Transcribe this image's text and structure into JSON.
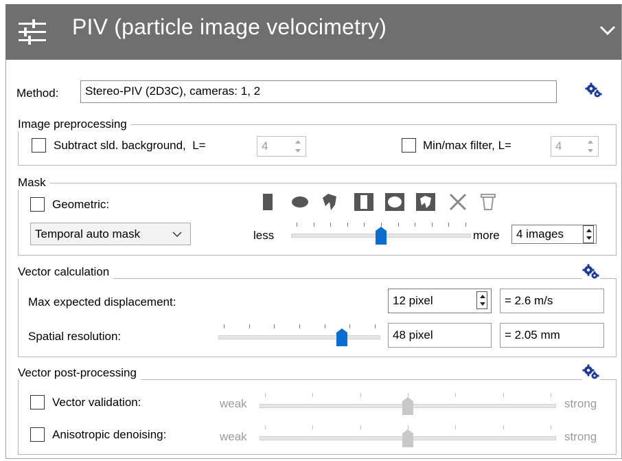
{
  "header": {
    "title": "PIV (particle image velocimetry)",
    "icons": [
      "sliders-icon",
      "chevron-down-icon"
    ]
  },
  "method": {
    "label": "Method:",
    "value": "Stereo-PIV (2D3C), cameras: 1, 2",
    "settings_icon": "gears-icon"
  },
  "image_preprocessing": {
    "title": "Image preprocessing",
    "subtract_background": {
      "label": "Subtract sld. background,  L=",
      "checked": false,
      "value": "4"
    },
    "minmax_filter": {
      "label": "Min/max filter, L=",
      "checked": false,
      "value": "4"
    }
  },
  "mask": {
    "title": "Mask",
    "geometric": {
      "label": "Geometric:",
      "checked": false
    },
    "tools": [
      "rectangle-mask-icon",
      "ellipse-mask-icon",
      "polygon-mask-icon",
      "inverse-rectangle-mask-icon",
      "inverse-ellipse-mask-icon",
      "inverse-polygon-mask-icon",
      "clear-mask-icon",
      "delete-mask-icon"
    ],
    "temporal_select": "Temporal auto mask",
    "slider_less": "less",
    "slider_more": "more",
    "slider_level": 0.5,
    "images_value": "4 images"
  },
  "vector_calculation": {
    "title": "Vector calculation",
    "max_disp_label": "Max expected displacement:",
    "max_disp_value": "12 pixel",
    "max_disp_result": "= 2.6 m/s",
    "spatial_label": "Spatial resolution:",
    "spatial_level": 0.78,
    "spatial_value": "48 pixel",
    "spatial_result": "= 2.05 mm"
  },
  "vector_post": {
    "title": "Vector post-processing",
    "validation": {
      "label": "Vector validation:",
      "checked": false,
      "level": 0.5
    },
    "denoising": {
      "label": "Anisotropic denoising:",
      "checked": false,
      "level": 0.5
    },
    "weak_label": "weak",
    "strong_label": "strong"
  },
  "colors": {
    "header_bg": "#6f6f6f",
    "accent_blue": "#0a6ed1",
    "gear_blue": "#1a3a9c",
    "disabled": "#9a9a9a"
  }
}
